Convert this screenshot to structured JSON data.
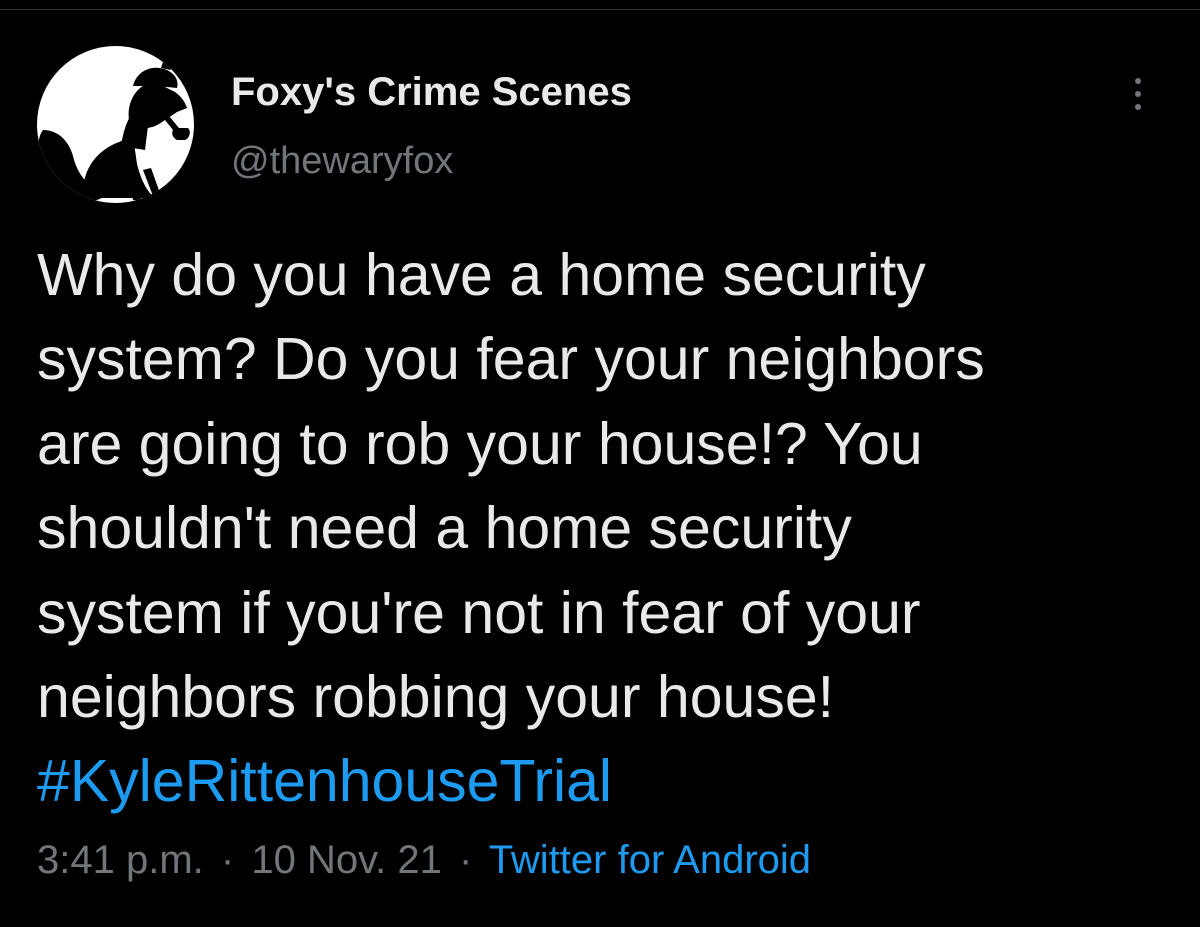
{
  "tweet": {
    "author": {
      "display_name": "Foxy's Crime Scenes",
      "handle": "@thewaryfox",
      "avatar_icon": "fox-detective-silhouette-icon"
    },
    "more_icon": "more-vertical-icon",
    "text_lines": [
      "Why do you have a home security",
      "system? Do you fear your neighbors",
      "are going to rob your house!? You",
      "shouldn't need a home security",
      "system if you're not in fear of your",
      "neighbors robbing your house!"
    ],
    "hashtag": "#KyleRittenhouseTrial",
    "meta": {
      "time": "3:41 p.m.",
      "separator": "·",
      "date": "10 Nov. 21",
      "source": "Twitter for Android"
    }
  },
  "colors": {
    "background": "#000000",
    "text_primary": "#e7e9ea",
    "text_secondary": "#71767b",
    "accent_link": "#1d9bf0"
  }
}
